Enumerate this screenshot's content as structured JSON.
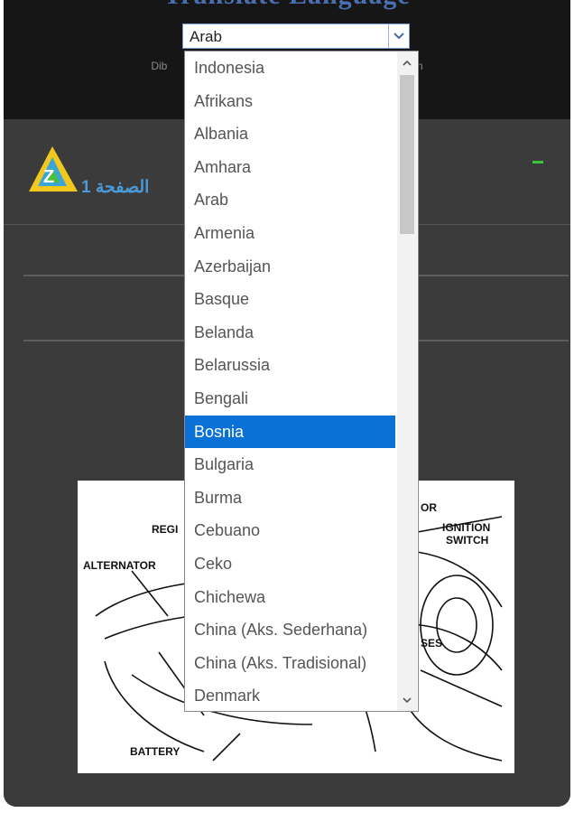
{
  "header": {
    "title": "Translate Language",
    "powered_left": "Dib",
    "powered_right": "an"
  },
  "language_select": {
    "current_value": "Arab",
    "arrow_icon": "chevron-down-icon"
  },
  "page": {
    "label": "الصفحة 1",
    "logo": "zn-logo-icon",
    "collapse": "minus-icon"
  },
  "dropdown": {
    "selected": "Bosnia",
    "options": [
      "Indonesia",
      "Afrikans",
      "Albania",
      "Amhara",
      "Arab",
      "Armenia",
      "Azerbaijan",
      "Basque",
      "Belanda",
      "Belarussia",
      "Bengali",
      "Bosnia",
      "Bulgaria",
      "Burma",
      "Cebuano",
      "Ceko",
      "Chichewa",
      "China (Aks. Sederhana)",
      "China (Aks. Tradisional)",
      "Denmark"
    ],
    "scroll_up_icon": "chevron-up-icon",
    "scroll_down_icon": "chevron-down-icon"
  },
  "diagram": {
    "labels": {
      "reg": "REGI",
      "alternator": "ALTERNATOR",
      "or": "OR",
      "ignition": "IGNITION",
      "switch": "SWITCH",
      "ses": "SES",
      "battery": "BATTERY"
    }
  },
  "colors": {
    "selected_bg": "#0a72d6",
    "page_label": "#4a9ad8",
    "minus": "#3dc23d"
  }
}
